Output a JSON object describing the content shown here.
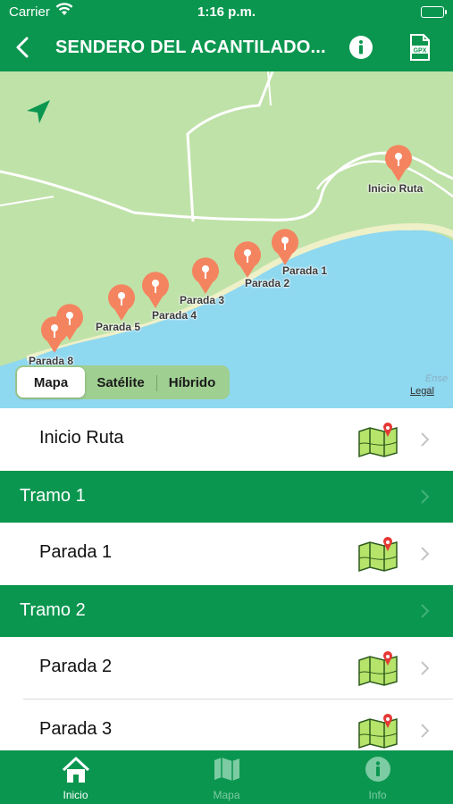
{
  "status_bar": {
    "carrier": "Carrier",
    "time": "1:16 p.m."
  },
  "nav": {
    "title": "SENDERO DEL ACANTILADO...",
    "back_icon": "chevron-left-icon",
    "info_icon": "info-icon",
    "gpx_icon": "gpx-file-icon"
  },
  "map": {
    "pins": [
      {
        "label": "Inicio Ruta"
      },
      {
        "label": "Parada 1"
      },
      {
        "label": "Parada 2"
      },
      {
        "label": "Parada 3"
      },
      {
        "label": "Parada 4"
      },
      {
        "label": "Parada 5"
      },
      {
        "label": "Parada 8"
      }
    ],
    "map_types": [
      "Mapa",
      "Satélite",
      "Híbrido"
    ],
    "selected_map_type": "Mapa",
    "legal": "Legal",
    "faint_label": "Ense d",
    "pin_color": "#f4845f"
  },
  "list": {
    "rows": [
      {
        "kind": "item",
        "label": "Inicio Ruta"
      },
      {
        "kind": "section",
        "label": "Tramo 1"
      },
      {
        "kind": "item",
        "label": "Parada 1"
      },
      {
        "kind": "section",
        "label": "Tramo 2"
      },
      {
        "kind": "item",
        "label": "Parada 2"
      },
      {
        "kind": "item",
        "label": "Parada 3"
      }
    ]
  },
  "tab_bar": {
    "tabs": [
      {
        "label": "Inicio",
        "icon": "home-icon",
        "active": true
      },
      {
        "label": "Mapa",
        "icon": "map-icon",
        "active": false
      },
      {
        "label": "Info",
        "icon": "info-icon",
        "active": false
      }
    ]
  },
  "colors": {
    "primary": "#0b9650",
    "water": "#8ed8f0",
    "land": "#bfe2a8"
  }
}
